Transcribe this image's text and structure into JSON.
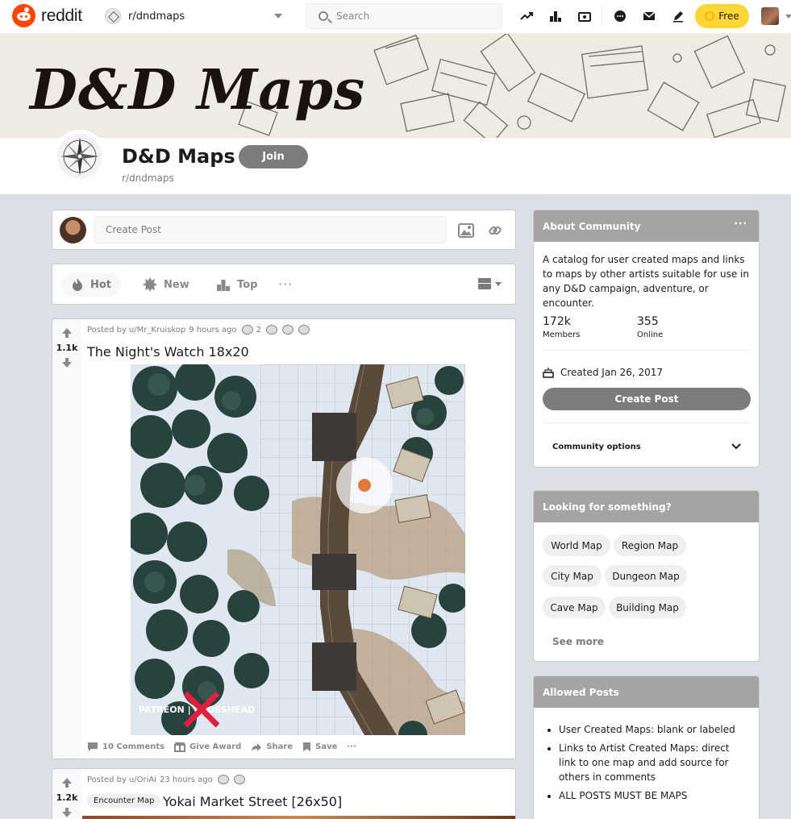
{
  "header": {
    "logo_text": "reddit",
    "community_dropdown": "r/dndmaps",
    "search_placeholder": "Search",
    "free_label": "Free"
  },
  "banner": {
    "title": "D&D Maps"
  },
  "community": {
    "title": "D&D Maps",
    "subreddit": "r/dndmaps",
    "join_label": "Join"
  },
  "create_post": {
    "placeholder": "Create Post"
  },
  "sort": {
    "items": [
      {
        "label": "Hot",
        "active": true
      },
      {
        "label": "New",
        "active": false
      },
      {
        "label": "Top",
        "active": false
      }
    ],
    "more": "···"
  },
  "posts": [
    {
      "score": "1.1k",
      "posted_by": "Posted by",
      "user": "u/Mr_Kruiskop",
      "time": "9 hours ago",
      "award_count": "2",
      "title": "The Night's Watch 18x20",
      "watermark": "PATREON | CROSSHEAD",
      "comments": "10 Comments",
      "give_award": "Give Award",
      "share": "Share",
      "save": "Save",
      "more": "···"
    },
    {
      "score": "1.2k",
      "posted_by": "Posted by",
      "user": "u/OriAi",
      "time": "23 hours ago",
      "flair": "Encounter Map",
      "title": "Yokai Market Street [26x50]"
    }
  ],
  "sidebar": {
    "about": {
      "heading": "About Community",
      "description": "A catalog for user created maps and links to maps by other artists suitable for use in any D&D campaign, adventure, or encounter.",
      "members_count": "172k",
      "members_label": "Members",
      "online_count": "355",
      "online_label": "Online",
      "created": "Created Jan 26, 2017",
      "create_post_label": "Create Post",
      "options_label": "Community options"
    },
    "looking": {
      "heading": "Looking for something?",
      "chips": [
        "World Map",
        "Region Map",
        "City Map",
        "Dungeon Map",
        "Cave Map",
        "Building Map"
      ],
      "see_more": "See more"
    },
    "allowed": {
      "heading": "Allowed Posts",
      "items": [
        "User Created Maps: blank or labeled",
        "Links to Artist Created Maps: direct link to one map and add source for others in comments",
        "ALL POSTS MUST BE MAPS"
      ]
    }
  },
  "colors": {
    "brand": "#ff4500",
    "premium": "#ffd635",
    "community_button": "#7c7c7c",
    "sidebar_header": "#a5a4a4"
  }
}
